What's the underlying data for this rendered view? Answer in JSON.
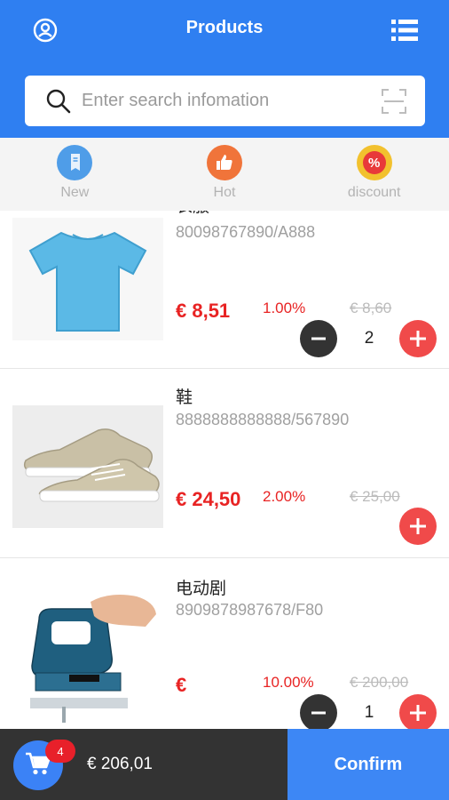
{
  "header": {
    "title": "Products",
    "left_icon": "user-circle-icon",
    "right_icon": "list-menu-icon"
  },
  "search": {
    "placeholder": "Enter search infomation",
    "icon": "search-icon",
    "scan_icon": "scan-icon"
  },
  "tabs": [
    {
      "label": "New",
      "icon": "new-tag-icon",
      "color": "#4f9de8"
    },
    {
      "label": "Hot",
      "icon": "thumbs-up-icon",
      "color": "#f0743a"
    },
    {
      "label": "discount",
      "icon": "percent-icon",
      "color": "#f2c12e"
    }
  ],
  "products": [
    {
      "name": "衣服",
      "code": "80098767890/A888",
      "price": "€ 8,51",
      "discount": "1.00%",
      "old_price": "€ 8,60",
      "quantity": "2"
    },
    {
      "name": "鞋",
      "code": "8888888888888/567890",
      "price": "€ 24,50",
      "discount": "2.00%",
      "old_price": "€ 25,00",
      "quantity": ""
    },
    {
      "name": "电动剧",
      "code": "8909878987678/F80",
      "price": "€",
      "discount": "10.00%",
      "old_price": "€ 200,00",
      "quantity": "1"
    }
  ],
  "bottom": {
    "cart_count": "4",
    "total": "€ 206,01",
    "confirm_label": "Confirm"
  },
  "colors": {
    "primary": "#2f7ff1",
    "price_red": "#e82323",
    "plus_red": "#f04a4a",
    "dark": "#333333"
  }
}
